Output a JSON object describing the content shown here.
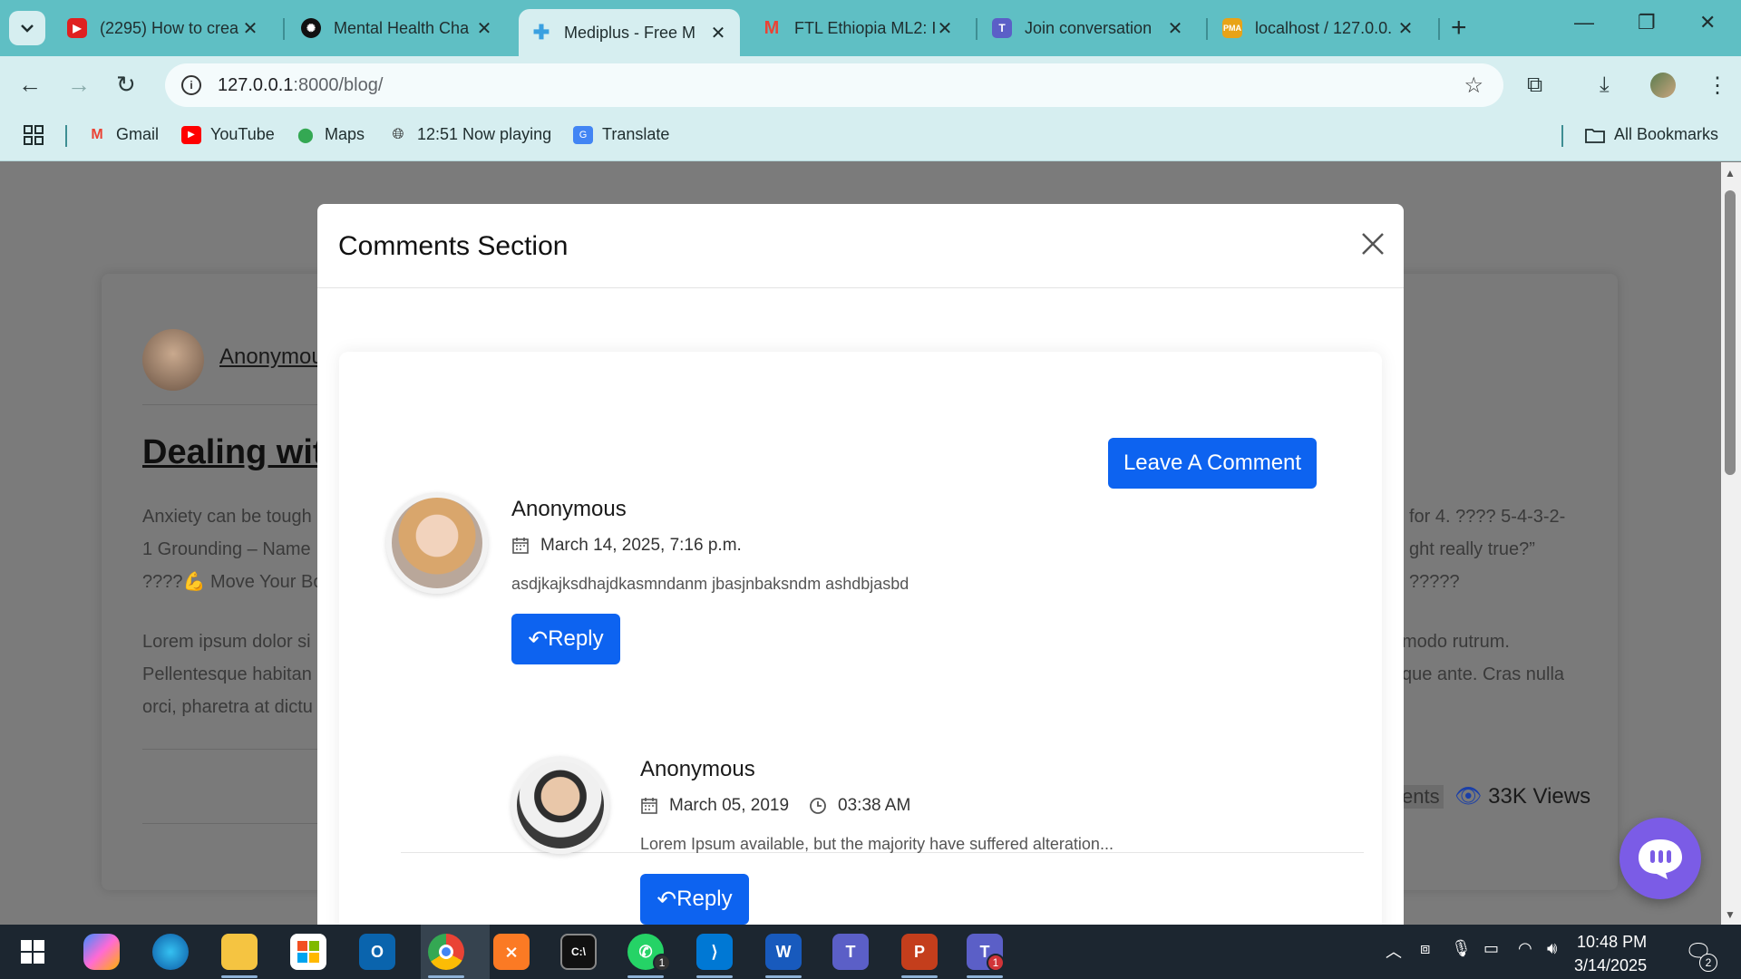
{
  "tabs": [
    {
      "title": "(2295) How to crea",
      "fav_color": "#e02020",
      "fav_icon": "youtube-icon"
    },
    {
      "title": "Mental Health Cha",
      "fav_color": "#111111",
      "fav_icon": "openai-icon"
    },
    {
      "title": "Mediplus - Free M",
      "fav_color": "#3aa0e0",
      "fav_icon": "medical-cross-icon",
      "active": true
    },
    {
      "title": "FTL Ethiopia ML2: I",
      "fav_color": "#ea4335",
      "fav_icon": "gmail-icon"
    },
    {
      "title": "Join conversation",
      "fav_color": "#5b5fc7",
      "fav_icon": "teams-icon"
    },
    {
      "title": "localhost / 127.0.0.",
      "fav_color": "#e8a317",
      "fav_icon": "phpmyadmin-icon"
    }
  ],
  "address": {
    "host": "127.0.0.1",
    "path": ":8000/blog/"
  },
  "bookmarks": {
    "items": [
      {
        "label": "Gmail",
        "icon": "gmail-icon",
        "color": "#ea4335"
      },
      {
        "label": "YouTube",
        "icon": "youtube-icon",
        "color": "#ff0000"
      },
      {
        "label": "Maps",
        "icon": "maps-pin-icon",
        "color": "#34a853"
      },
      {
        "label": "12:51 Now playing",
        "icon": "globe-icon",
        "color": "#222222"
      },
      {
        "label": "Translate",
        "icon": "translate-icon",
        "color": "#4285f4"
      }
    ],
    "all_label": "All Bookmarks"
  },
  "blog": {
    "author": "Anonymou",
    "title": "Dealing wit",
    "para1_left": [
      "Anxiety can be tough",
      "1 Grounding – Name",
      "????💪 Move Your Bo"
    ],
    "para1_right": [
      "for 4. ???? 5-4-3-2-",
      "ght really true?”",
      "?????"
    ],
    "para2_left": [
      "Lorem ipsum dolor si",
      "Pellentesque habitan",
      "orci, pharetra at dictu"
    ],
    "para2_right": [
      "modo rutrum.",
      "que ante. Cras nulla",
      ""
    ],
    "comments_label": "ents",
    "views": "33K Views"
  },
  "modal": {
    "title": "Comments Section",
    "leave_comment": "Leave A Comment",
    "comments": [
      {
        "name": "Anonymous",
        "date": "March 14, 2025, 7:16 p.m.",
        "time": "",
        "text": "asdjkajksdhajdkasmndanm jbasjnbaksndm ashdbjasbd",
        "reply": "Reply"
      },
      {
        "name": "Anonymous",
        "date": "March 05, 2019",
        "time": "03:38 AM",
        "text": "Lorem Ipsum available, but the majority have suffered alteration...",
        "reply": "Reply"
      }
    ]
  },
  "taskbar": {
    "time": "10:48 PM",
    "date": "3/14/2025",
    "notification_count": "2",
    "whatsapp_badge": "1",
    "teams_badge": "1"
  }
}
